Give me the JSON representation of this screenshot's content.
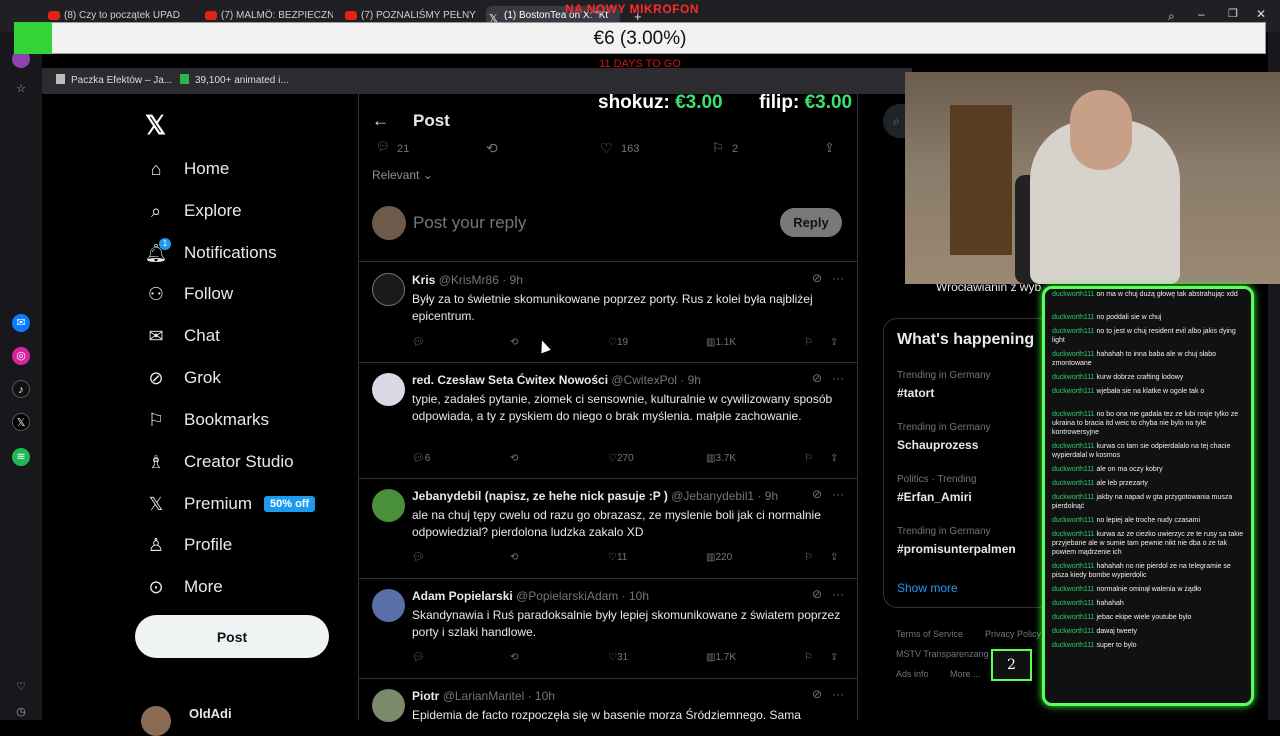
{
  "browser": {
    "tabs": [
      {
        "label": "(8) Czy to początek UPADK"
      },
      {
        "label": "(7) MALMÖ: BEZPIECZNE"
      },
      {
        "label": "(7) POZNALIŚMY PEŁNY W"
      },
      {
        "label": "(1) BostonTea on X: \"Kt"
      }
    ],
    "bookmarks": [
      {
        "label": "Paczka Efektów – Ja..."
      },
      {
        "label": "39,100+ animated i..."
      }
    ]
  },
  "stream": {
    "overlay_title": "NA NOWY MIKROFON",
    "goal_text": "€6 (3.00%)",
    "goal_fraction": 0.03,
    "goal_days": "11 DAYS TO GO",
    "tips": [
      {
        "name": "shokuz:",
        "amount": "€3.00"
      },
      {
        "name": "filip:",
        "amount": "€3.00"
      }
    ],
    "counter": "2"
  },
  "sidebar": {
    "logo": "X",
    "items": [
      {
        "label": "Home",
        "icon": "home-icon"
      },
      {
        "label": "Explore",
        "icon": "search-icon"
      },
      {
        "label": "Notifications",
        "icon": "bell-icon",
        "badge": "1"
      },
      {
        "label": "Follow",
        "icon": "follow-icon"
      },
      {
        "label": "Chat",
        "icon": "mail-icon"
      },
      {
        "label": "Grok",
        "icon": "grok-icon"
      },
      {
        "label": "Bookmarks",
        "icon": "bookmark-icon"
      },
      {
        "label": "Creator Studio",
        "icon": "creator-icon"
      },
      {
        "label": "Premium",
        "icon": "x-icon",
        "tag": "50% off"
      },
      {
        "label": "Profile",
        "icon": "profile-icon"
      },
      {
        "label": "More",
        "icon": "more-icon"
      }
    ],
    "post_button": "Post",
    "account_name": "OldAdi"
  },
  "main": {
    "header": "Post",
    "stats": {
      "replies": "21",
      "likes": "163",
      "bookmarks": "2"
    },
    "sort": "Relevant",
    "reply_placeholder": "Post your reply",
    "reply_button": "Reply",
    "tweets": [
      {
        "name": "Kris",
        "handle": "@KrisMr86",
        "time": "· 9h",
        "text": "Były za to świetnie skomunikowane poprzez porty. Rus z kolei była najbliżej epicentrum.",
        "likes": "19",
        "views": "1.1K",
        "replies": "",
        "retweets": "",
        "avatar_color": "#1a1a1a"
      },
      {
        "name": "red. Czesław Seta Ćwitex Nowości",
        "handle": "@CwitexPol",
        "time": "· 9h",
        "text": "typie, zadałeś pytanie, ziomek ci sensownie, kulturalnie w cywilizowany sposób odpowiada, a ty z pyskiem do niego o brak myślenia. małpie zachowanie.",
        "likes": "270",
        "views": "3.7K",
        "replies": "6",
        "retweets": "",
        "avatar_color": "#d9d9e6"
      },
      {
        "name": "Jebanydebil (napisz, ze hehe nick pasuje :P )",
        "handle": "@Jebanydebil1",
        "time": "· 9h",
        "text": "ale na chuj tępy cwelu od razu go obrazasz, ze myslenie boli jak ci normalnie odpowiedzial? pierdolona ludzka zakalo XD",
        "likes": "11",
        "views": "220",
        "replies": "",
        "retweets": "",
        "avatar_color": "#4a8f3a"
      },
      {
        "name": "Adam Popielarski",
        "handle": "@PopielarskiAdam",
        "time": "· 10h",
        "text": "Skandynawia i Ruś paradoksalnie były lepiej skomunikowane z światem poprzez porty i szlaki handlowe.",
        "likes": "31",
        "views": "1.7K",
        "replies": "",
        "retweets": "",
        "avatar_color": "#5a6fa8"
      },
      {
        "name": "Piotr",
        "handle": "@LarianMaritel",
        "time": "· 10h",
        "text": "Epidemia de facto rozpoczęła się w basenie morza Śródziemnego. Sama",
        "likes": "",
        "views": "",
        "replies": "",
        "retweets": "",
        "avatar_color": "#7a8a6a"
      }
    ]
  },
  "right": {
    "partial_text": "Wrocławianin z wyb",
    "trends_title": "What's happening",
    "trends": [
      {
        "meta": "Trending in Germany",
        "tag": "#tatort"
      },
      {
        "meta": "Trending in Germany",
        "tag": "Schauprozess"
      },
      {
        "meta": "Politics · Trending",
        "tag": "#Erfan_Amiri"
      },
      {
        "meta": "Trending in Germany",
        "tag": "#promisunterpalmen"
      }
    ],
    "show_more": "Show more",
    "footer": [
      "Terms of Service",
      "Privacy Policy",
      "MSTV Transparenzang",
      "Ads info",
      "More ..."
    ]
  },
  "chat": [
    {
      "user": "duckworth111",
      "text": "on ma w chuj dużą głowę tak abstrahując xdd"
    },
    {
      "user": "duckworth111",
      "text": "no poddali sie w chuj"
    },
    {
      "user": "duckworth111",
      "text": "no to jest w chuj resident evil albo jakis dying light"
    },
    {
      "user": "duckworth111",
      "text": "hahahah to inna baba ale w chuj słabo zmontowane"
    },
    {
      "user": "duckworth111",
      "text": "kurw dobrze crafting lodowy"
    },
    {
      "user": "duckworth111",
      "text": "wjebała sie na klatke w ogole tak o"
    },
    {
      "user": "duckworth111",
      "text": "no bo ona nie gadala tez ze lubi rosje tylko ze ukraina to bracia itd weic to chyba nie bylo na tyle kontrowersyjne"
    },
    {
      "user": "duckworth111",
      "text": "kurwa co tam sie odpierdalalo na tej chacie wypierdalal w kosmos"
    },
    {
      "user": "duckworth111",
      "text": "ale on ma oczy kobry"
    },
    {
      "user": "duckworth111",
      "text": "ale leb przezarty"
    },
    {
      "user": "duckworth111",
      "text": "jakby na napad w gta przygotowania musza pierdolnąć"
    },
    {
      "user": "duckworth111",
      "text": "no lepiej ale troche nudy czasami"
    },
    {
      "user": "duckworth111",
      "text": "kurwa az ze ciezko uwierzyc ze te rusy sa takie przyjebane ale w sumie tam pewnie nikt nie dba o ze tak powiem mądrzenie ich"
    },
    {
      "user": "duckworth111",
      "text": "hahahah no nie pierdol ze na telegramie se pisza kiedy bombe wypierdolic"
    },
    {
      "user": "duckworth111",
      "text": "normalnie ominął walenia w żądło"
    },
    {
      "user": "duckworth111",
      "text": "hahahah"
    },
    {
      "user": "duckworth111",
      "text": "jebac ekipe wiele youtube bylo"
    },
    {
      "user": "duckworth111",
      "text": "dawaj tweety"
    },
    {
      "user": "duckworth111",
      "text": "super to bylo"
    }
  ]
}
